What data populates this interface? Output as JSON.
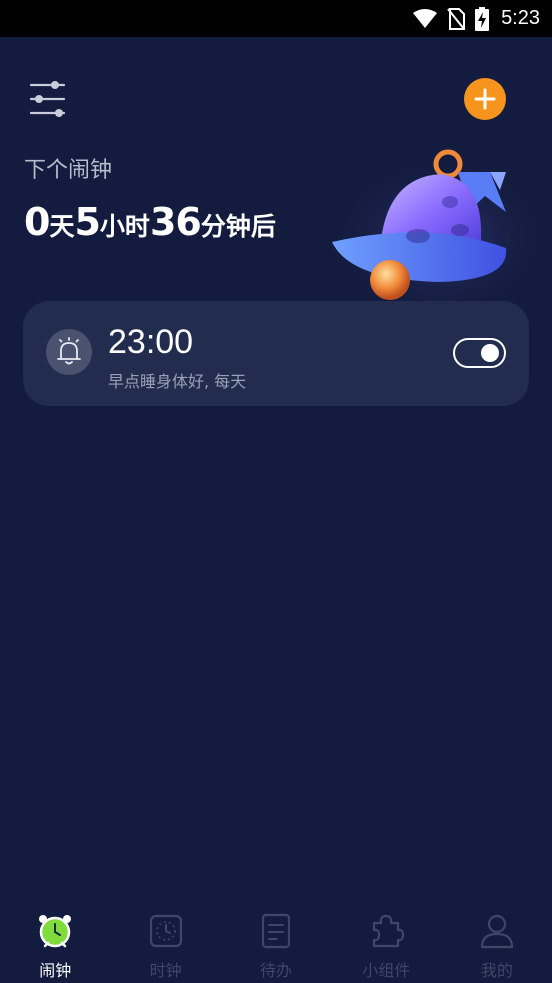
{
  "status_bar": {
    "time": "5:23",
    "icons": [
      "wifi-icon",
      "no-sim-icon",
      "battery-charging-icon"
    ]
  },
  "header": {
    "menu_icon": "sliders-icon",
    "add_icon": "plus-icon",
    "accent_color": "#f7941d"
  },
  "next_alarm": {
    "label": "下个闹钟",
    "days": "0",
    "days_unit": "天",
    "hours": "5",
    "hours_unit": "小时",
    "minutes": "36",
    "minutes_unit": "分钟后"
  },
  "alarms": [
    {
      "time": "23:00",
      "description": "早点睡身体好, 每天",
      "enabled": true,
      "icon": "bell-icon"
    }
  ],
  "tabs": [
    {
      "label": "闹钟",
      "icon": "alarm-clock-icon",
      "active": true
    },
    {
      "label": "时钟",
      "icon": "clock-icon",
      "active": false
    },
    {
      "label": "待办",
      "icon": "todo-icon",
      "active": false
    },
    {
      "label": "小组件",
      "icon": "puzzle-icon",
      "active": false
    },
    {
      "label": "我的",
      "icon": "user-icon",
      "active": false
    }
  ],
  "colors": {
    "background": "#131c3f",
    "card": "#212c4f",
    "tab_inactive": "#3f4766",
    "tab_active": "#ffffff"
  }
}
